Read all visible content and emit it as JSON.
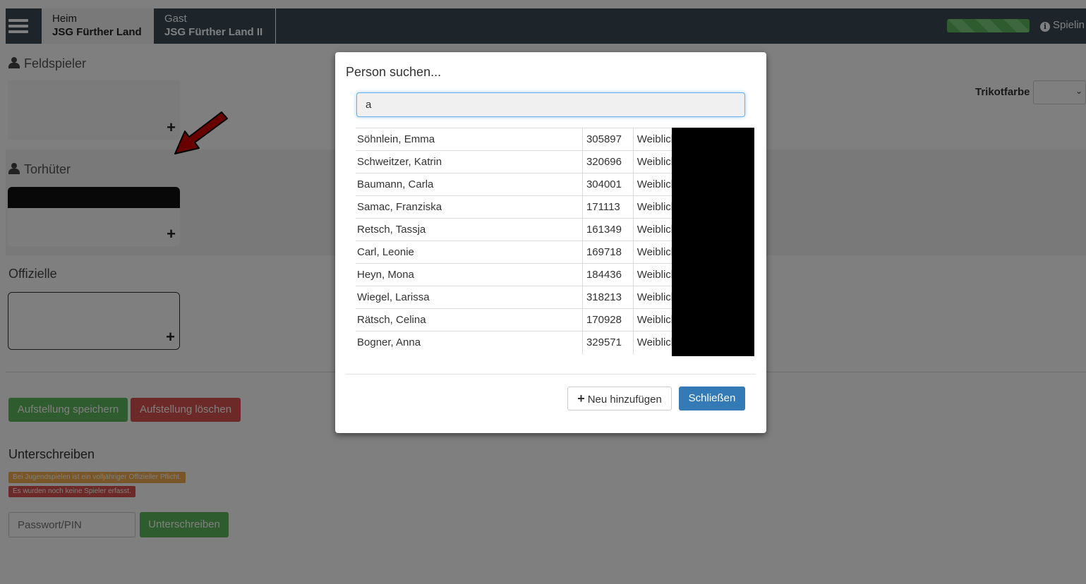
{
  "header": {
    "home": {
      "label": "Heim",
      "team": "JSG Fürther Land"
    },
    "guest": {
      "label": "Gast",
      "team": "JSG Fürther Land II"
    },
    "info_label": "Spielin",
    "progress_fraction": 1.0
  },
  "lineup": {
    "field_players_title": "Feldspieler",
    "goalkeepers_title": "Torhüter",
    "officials_title": "Offizielle",
    "shirt_color_label": "Trikotfarbe",
    "add_symbol": "+",
    "save_button": "Aufstellung speichern",
    "delete_button": "Aufstellung löschen"
  },
  "signing": {
    "title": "Unterschreiben",
    "warning_badge": "Bei Jugendspielen ist ein volljähriger Offizieller Pflicht.",
    "error_badge": "Es wurden noch keine Spieler erfasst.",
    "pin_placeholder": "Passwort/PIN",
    "sign_button": "Unterschreiben"
  },
  "modal": {
    "title": "Person suchen...",
    "search_value": "a",
    "results": [
      {
        "name": "Söhnlein, Emma",
        "id": "305897",
        "sex": "Weiblich"
      },
      {
        "name": "Schweitzer, Katrin",
        "id": "320696",
        "sex": "Weiblich"
      },
      {
        "name": "Baumann, Carla",
        "id": "304001",
        "sex": "Weiblich"
      },
      {
        "name": "Samac, Franziska",
        "id": "171113",
        "sex": "Weiblich"
      },
      {
        "name": "Retsch, Tassja",
        "id": "161349",
        "sex": "Weiblich"
      },
      {
        "name": "Carl, Leonie",
        "id": "169718",
        "sex": "Weiblich"
      },
      {
        "name": "Heyn, Mona",
        "id": "184436",
        "sex": "Weiblich"
      },
      {
        "name": "Wiegel, Larissa",
        "id": "318213",
        "sex": "Weiblich"
      },
      {
        "name": "Rätsch, Celina",
        "id": "170928",
        "sex": "Weiblich"
      },
      {
        "name": "Bogner, Anna",
        "id": "329571",
        "sex": "Weiblich"
      }
    ],
    "add_new_button": "Neu hinzufügen",
    "close_button": "Schließen"
  },
  "colors": {
    "topbar": "#3a4b55",
    "primary": "#337ab7",
    "success": "#5cb85c",
    "danger": "#d9534f",
    "warning": "#f0ad4e"
  }
}
